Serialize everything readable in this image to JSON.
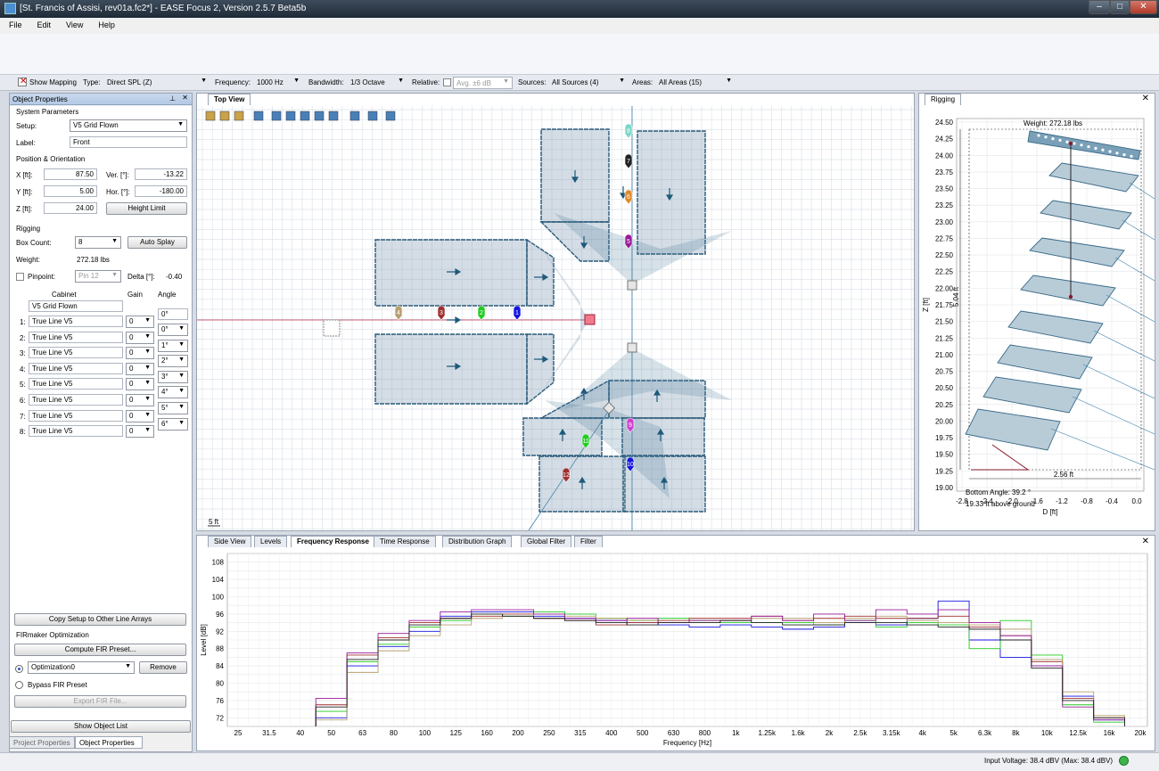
{
  "title_bar": {
    "title": "[St. Francis of Assisi, rev01a.fc2*] - EASE Focus 2, Version 2.5.7 Beta5b",
    "minimize": "–",
    "maximize": "□",
    "close": "✕"
  },
  "menu": [
    "File",
    "Edit",
    "View",
    "Help"
  ],
  "options_bar": {
    "show_mapping": "Show Mapping",
    "type_label": "Type:",
    "type_value": "Direct SPL (Z)",
    "frequency_label": "Frequency:",
    "frequency_value": "1000 Hz",
    "bandwidth_label": "Bandwidth:",
    "bandwidth_value": "1/3 Octave",
    "relative_label": "Relative:",
    "relative_value": "Avg. ±6 dB",
    "sources_label": "Sources:",
    "sources_value": "All Sources (4)",
    "areas_label": "Areas:",
    "areas_value": "All Areas (15)"
  },
  "object_properties": {
    "header": "Object Properties",
    "system_parameters": "System Parameters",
    "setup_label": "Setup:",
    "setup_value": "V5 Grid Flown",
    "label_label": "Label:",
    "label_value": "Front",
    "position_section": "Position & Orientation",
    "x_label": "X [ft]:",
    "x_value": "87.50",
    "y_label": "Y [ft]:",
    "y_value": "5.00",
    "z_label": "Z [ft]:",
    "z_value": "24.00",
    "ver_label": "Ver. [°]:",
    "ver_value": "-13.22",
    "hor_label": "Hor. [°]:",
    "hor_value": "-180.00",
    "height_limit": "Height Limit",
    "rigging_section": "Rigging",
    "box_count_label": "Box Count:",
    "box_count_value": "8",
    "auto_splay": "Auto Splay",
    "weight_label": "Weight:",
    "weight_value": "272.18 lbs",
    "pinpoint_label": "Pinpoint:",
    "pinpoint_value": "Pin 12",
    "delta_label": "Delta [°]:",
    "delta_value": "-0.40",
    "cabinet_header": "Cabinet",
    "gain_header": "Gain",
    "angle_header": "Angle",
    "grid_name": "V5 Grid Flown",
    "top_angle": "0°",
    "cabinets": [
      {
        "index": "1:",
        "name": "True Line V5",
        "gain": "0",
        "angle": "0°"
      },
      {
        "index": "2:",
        "name": "True Line V5",
        "gain": "0",
        "angle": "1°"
      },
      {
        "index": "3:",
        "name": "True Line V5",
        "gain": "0",
        "angle": "2°"
      },
      {
        "index": "4:",
        "name": "True Line V5",
        "gain": "0",
        "angle": "3°"
      },
      {
        "index": "5:",
        "name": "True Line V5",
        "gain": "0",
        "angle": "4°"
      },
      {
        "index": "6:",
        "name": "True Line V5",
        "gain": "0",
        "angle": "5°"
      },
      {
        "index": "7:",
        "name": "True Line V5",
        "gain": "0",
        "angle": "6°"
      },
      {
        "index": "8:",
        "name": "True Line V5",
        "gain": "0"
      }
    ],
    "copy_setup": "Copy Setup to Other Line Arrays",
    "fir_section": "FIRmaker Optimization",
    "compute_fir": "Compute FIR Preset...",
    "optimization_value": "Optimization0",
    "remove": "Remove",
    "bypass_fir": "Bypass FIR Preset",
    "export_fir": "Export FIR File...",
    "show_object_list": "Show Object List",
    "tab_project": "Project Properties",
    "tab_object": "Object Properties"
  },
  "top_view": {
    "tab": "Top View",
    "scale_label": "5 ft",
    "source_markers": [
      {
        "label": "1",
        "color": "#1515e0"
      },
      {
        "label": "2",
        "color": "#22cc22"
      },
      {
        "label": "3",
        "color": "#a03030"
      },
      {
        "label": "4",
        "color": "#b8a070"
      },
      {
        "label": "5",
        "color": "#9a1a9a"
      },
      {
        "label": "6",
        "color": "#e08a2a"
      },
      {
        "label": "7",
        "color": "#222222"
      },
      {
        "label": "8",
        "color": "#7ad8c8"
      },
      {
        "label": "9",
        "color": "#d040d0"
      },
      {
        "label": "10",
        "color": "#1515e0"
      },
      {
        "label": "11",
        "color": "#22cc22"
      },
      {
        "label": "12",
        "color": "#a03030"
      }
    ]
  },
  "rigging_view": {
    "tab": "Rigging",
    "weight": "Weight: 272.18 lbs",
    "bottom_angle": "Bottom Angle: 39.2 °",
    "above_ground": "19.33 ft above ground",
    "height_dim": "5.04 ft",
    "width_dim": "2.56 ft",
    "xlabel": "D [ft]",
    "ylabel": "Z [ft]",
    "y_ticks": [
      "24.50",
      "24.25",
      "24.00",
      "23.75",
      "23.50",
      "23.25",
      "23.00",
      "22.75",
      "22.50",
      "22.25",
      "22.00",
      "21.75",
      "21.50",
      "21.25",
      "21.00",
      "20.75",
      "20.50",
      "20.25",
      "20.00",
      "19.75",
      "19.50",
      "19.25",
      "19.00"
    ],
    "x_ticks": [
      "-2.8",
      "-2.4",
      "-2.0",
      "-1.6",
      "-1.2",
      "-0.8",
      "-0.4",
      "0.0"
    ]
  },
  "bottom_tabs": [
    "Side View",
    "Levels",
    "Frequency Response",
    "Time Response",
    "Distribution Graph",
    "Global Filter",
    "Filter"
  ],
  "chart_data": {
    "type": "line",
    "xlabel": "Frequency [Hz]",
    "ylabel": "Level [dB]",
    "ylim": [
      70,
      110
    ],
    "grid": true,
    "y_ticks": [
      "108",
      "104",
      "100",
      "96",
      "92",
      "88",
      "84",
      "80",
      "76",
      "72"
    ],
    "categories": [
      "25",
      "31.5",
      "40",
      "50",
      "63",
      "80",
      "100",
      "125",
      "160",
      "200",
      "250",
      "315",
      "400",
      "500",
      "630",
      "800",
      "1k",
      "1.25k",
      "1.6k",
      "2k",
      "2.5k",
      "3.15k",
      "4k",
      "5k",
      "6.3k",
      "8k",
      "10k",
      "12.5k",
      "16k",
      "20k"
    ],
    "series": [
      {
        "color": "#1515e0",
        "values": [
          null,
          null,
          null,
          72.0,
          84.0,
          88.5,
          92.0,
          95.5,
          96.5,
          96.5,
          95.5,
          95.0,
          94.5,
          94.0,
          93.5,
          93.0,
          93.5,
          93.0,
          92.5,
          93.0,
          94.0,
          93.5,
          95.0,
          99.0,
          90.0,
          86.0,
          84.0,
          77.0,
          71.5,
          null
        ]
      },
      {
        "color": "#22cc22",
        "values": [
          null,
          null,
          null,
          73.5,
          85.0,
          89.0,
          93.0,
          94.5,
          96.0,
          95.5,
          96.5,
          96.0,
          95.0,
          94.5,
          95.0,
          94.5,
          94.0,
          94.0,
          94.0,
          93.5,
          94.5,
          93.0,
          94.0,
          93.5,
          88.0,
          94.5,
          86.5,
          75.0,
          71.0,
          null
        ]
      },
      {
        "color": "#a03030",
        "values": [
          null,
          null,
          null,
          75.0,
          86.5,
          90.5,
          94.0,
          95.0,
          95.5,
          96.0,
          95.0,
          94.5,
          93.5,
          94.0,
          94.5,
          95.0,
          95.0,
          95.5,
          94.5,
          95.0,
          95.5,
          95.0,
          95.0,
          95.5,
          93.0,
          91.0,
          85.0,
          76.5,
          72.0,
          null
        ]
      },
      {
        "color": "#b8a070",
        "values": [
          null,
          null,
          null,
          71.5,
          82.5,
          87.5,
          91.0,
          93.5,
          95.0,
          95.5,
          96.0,
          95.5,
          95.0,
          94.5,
          94.0,
          94.0,
          94.5,
          95.0,
          95.0,
          94.0,
          95.0,
          95.5,
          94.5,
          94.0,
          93.5,
          92.5,
          85.5,
          78.0,
          72.5,
          null
        ]
      },
      {
        "color": "#9a1a9a",
        "values": [
          null,
          null,
          null,
          76.5,
          87.0,
          91.5,
          94.5,
          96.5,
          97.0,
          97.0,
          96.0,
          95.0,
          94.5,
          95.0,
          94.0,
          94.5,
          94.5,
          95.5,
          94.5,
          96.0,
          94.5,
          97.0,
          96.0,
          97.0,
          94.0,
          91.0,
          84.0,
          74.5,
          71.5,
          null
        ]
      },
      {
        "color": "#222222",
        "values": [
          null,
          null,
          null,
          74.5,
          85.5,
          90.0,
          93.5,
          95.0,
          96.0,
          95.5,
          95.0,
          94.5,
          94.0,
          93.5,
          94.0,
          94.0,
          94.5,
          94.0,
          93.5,
          93.5,
          94.0,
          94.0,
          93.5,
          93.0,
          92.5,
          90.0,
          83.5,
          76.0,
          72.0,
          null
        ]
      }
    ]
  },
  "status": {
    "text": "Input Voltage: 38.4 dBV (Max: 38.4 dBV)"
  }
}
